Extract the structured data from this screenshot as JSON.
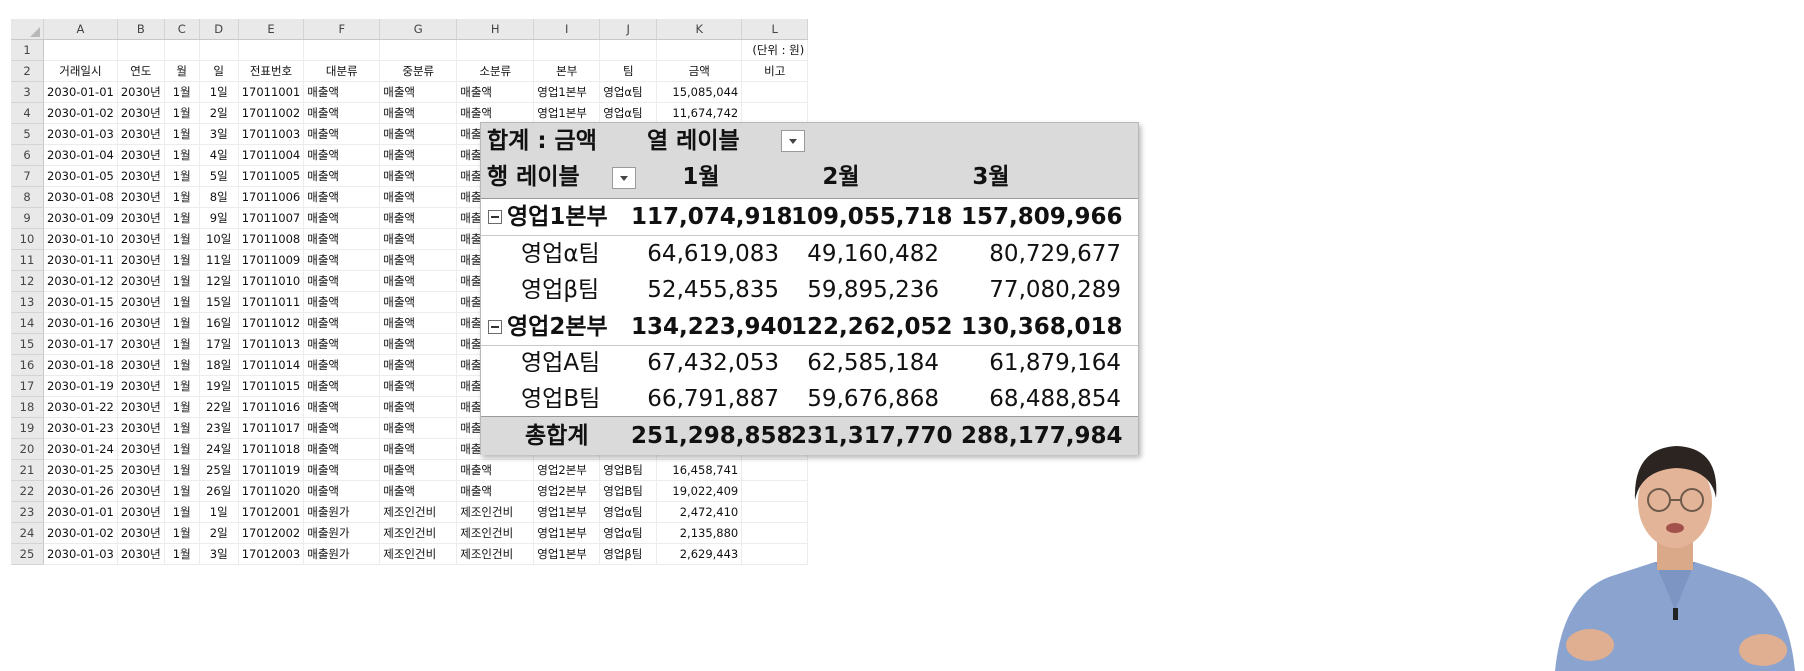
{
  "sheet": {
    "col_letters": [
      "A",
      "B",
      "C",
      "D",
      "E",
      "F",
      "G",
      "H",
      "I",
      "J",
      "K",
      "L"
    ],
    "unit_note": "(단위 : 원)",
    "headers": [
      "거래일시",
      "연도",
      "월",
      "일",
      "전표번호",
      "대분류",
      "중분류",
      "소분류",
      "본부",
      "팀",
      "금액",
      "비고"
    ],
    "rows": [
      {
        "num": "3",
        "c": [
          "2030-01-01",
          "2030년",
          "1월",
          "1일",
          "17011001",
          "매출액",
          "매출액",
          "매출액",
          "영업1본부",
          "영업α팀",
          "15,085,044",
          ""
        ]
      },
      {
        "num": "4",
        "c": [
          "2030-01-02",
          "2030년",
          "1월",
          "2일",
          "17011002",
          "매출액",
          "매출액",
          "매출액",
          "영업1본부",
          "영업α팀",
          "11,674,742",
          ""
        ]
      },
      {
        "num": "5",
        "c": [
          "2030-01-03",
          "2030년",
          "1월",
          "3일",
          "17011003",
          "매출액",
          "매출액",
          "매출",
          "",
          "",
          "",
          ""
        ]
      },
      {
        "num": "6",
        "c": [
          "2030-01-04",
          "2030년",
          "1월",
          "4일",
          "17011004",
          "매출액",
          "매출액",
          "매출",
          "",
          "",
          "",
          ""
        ]
      },
      {
        "num": "7",
        "c": [
          "2030-01-05",
          "2030년",
          "1월",
          "5일",
          "17011005",
          "매출액",
          "매출액",
          "매출",
          "",
          "",
          "",
          ""
        ]
      },
      {
        "num": "8",
        "c": [
          "2030-01-08",
          "2030년",
          "1월",
          "8일",
          "17011006",
          "매출액",
          "매출액",
          "매출",
          "",
          "",
          "",
          ""
        ]
      },
      {
        "num": "9",
        "c": [
          "2030-01-09",
          "2030년",
          "1월",
          "9일",
          "17011007",
          "매출액",
          "매출액",
          "매출",
          "",
          "",
          "",
          ""
        ]
      },
      {
        "num": "10",
        "c": [
          "2030-01-10",
          "2030년",
          "1월",
          "10일",
          "17011008",
          "매출액",
          "매출액",
          "매출",
          "",
          "",
          "",
          ""
        ]
      },
      {
        "num": "11",
        "c": [
          "2030-01-11",
          "2030년",
          "1월",
          "11일",
          "17011009",
          "매출액",
          "매출액",
          "매출",
          "",
          "",
          "",
          ""
        ]
      },
      {
        "num": "12",
        "c": [
          "2030-01-12",
          "2030년",
          "1월",
          "12일",
          "17011010",
          "매출액",
          "매출액",
          "매출",
          "",
          "",
          "",
          ""
        ]
      },
      {
        "num": "13",
        "c": [
          "2030-01-15",
          "2030년",
          "1월",
          "15일",
          "17011011",
          "매출액",
          "매출액",
          "매출",
          "",
          "",
          "",
          ""
        ]
      },
      {
        "num": "14",
        "c": [
          "2030-01-16",
          "2030년",
          "1월",
          "16일",
          "17011012",
          "매출액",
          "매출액",
          "매출",
          "",
          "",
          "",
          ""
        ]
      },
      {
        "num": "15",
        "c": [
          "2030-01-17",
          "2030년",
          "1월",
          "17일",
          "17011013",
          "매출액",
          "매출액",
          "매출",
          "",
          "",
          "",
          ""
        ]
      },
      {
        "num": "16",
        "c": [
          "2030-01-18",
          "2030년",
          "1월",
          "18일",
          "17011014",
          "매출액",
          "매출액",
          "매출",
          "",
          "",
          "",
          ""
        ]
      },
      {
        "num": "17",
        "c": [
          "2030-01-19",
          "2030년",
          "1월",
          "19일",
          "17011015",
          "매출액",
          "매출액",
          "매출",
          "",
          "",
          "",
          ""
        ]
      },
      {
        "num": "18",
        "c": [
          "2030-01-22",
          "2030년",
          "1월",
          "22일",
          "17011016",
          "매출액",
          "매출액",
          "매출",
          "",
          "",
          "",
          ""
        ]
      },
      {
        "num": "19",
        "c": [
          "2030-01-23",
          "2030년",
          "1월",
          "23일",
          "17011017",
          "매출액",
          "매출액",
          "매출",
          "",
          "",
          "",
          ""
        ]
      },
      {
        "num": "20",
        "c": [
          "2030-01-24",
          "2030년",
          "1월",
          "24일",
          "17011018",
          "매출액",
          "매출액",
          "매출",
          "",
          "",
          "",
          ""
        ]
      },
      {
        "num": "21",
        "c": [
          "2030-01-25",
          "2030년",
          "1월",
          "25일",
          "17011019",
          "매출액",
          "매출액",
          "매출액",
          "영업2본부",
          "영업B팀",
          "16,458,741",
          ""
        ]
      },
      {
        "num": "22",
        "c": [
          "2030-01-26",
          "2030년",
          "1월",
          "26일",
          "17011020",
          "매출액",
          "매출액",
          "매출액",
          "영업2본부",
          "영업B팀",
          "19,022,409",
          ""
        ]
      },
      {
        "num": "23",
        "c": [
          "2030-01-01",
          "2030년",
          "1월",
          "1일",
          "17012001",
          "매출원가",
          "제조인건비",
          "제조인건비",
          "영업1본부",
          "영업α팀",
          "2,472,410",
          ""
        ]
      },
      {
        "num": "24",
        "c": [
          "2030-01-02",
          "2030년",
          "1월",
          "2일",
          "17012002",
          "매출원가",
          "제조인건비",
          "제조인건비",
          "영업1본부",
          "영업α팀",
          "2,135,880",
          ""
        ]
      },
      {
        "num": "25",
        "c": [
          "2030-01-03",
          "2030년",
          "1월",
          "3일",
          "17012003",
          "매출원가",
          "제조인건비",
          "제조인건비",
          "영업1본부",
          "영업β팀",
          "2,629,443",
          ""
        ]
      }
    ]
  },
  "pivot": {
    "value_label": "합계 : 금액",
    "col_label": "열 레이블",
    "row_label": "행 레이블",
    "months": [
      "1월",
      "2월",
      "3월"
    ],
    "rows": [
      {
        "label": "영업1본부",
        "level": 0,
        "values": [
          "117,074,918",
          "109,055,718",
          "157,809,966"
        ]
      },
      {
        "label": "영업α팀",
        "level": 1,
        "values": [
          "64,619,083",
          "49,160,482",
          "80,729,677"
        ]
      },
      {
        "label": "영업β팀",
        "level": 1,
        "values": [
          "52,455,835",
          "59,895,236",
          "77,080,289"
        ]
      },
      {
        "label": "영업2본부",
        "level": 0,
        "values": [
          "134,223,940",
          "122,262,052",
          "130,368,018"
        ]
      },
      {
        "label": "영업A팀",
        "level": 1,
        "values": [
          "67,432,053",
          "62,585,184",
          "61,879,164"
        ]
      },
      {
        "label": "영업B팀",
        "level": 1,
        "values": [
          "66,791,887",
          "59,676,868",
          "68,488,854"
        ]
      }
    ],
    "total": {
      "label": "총합계",
      "values": [
        "251,298,858",
        "231,317,770",
        "288,177,984"
      ]
    }
  },
  "colors": {
    "header_grey": "#e9e9e9",
    "pivot_header_grey": "#dadada",
    "presenter_shirt": "#8aa3cf"
  }
}
